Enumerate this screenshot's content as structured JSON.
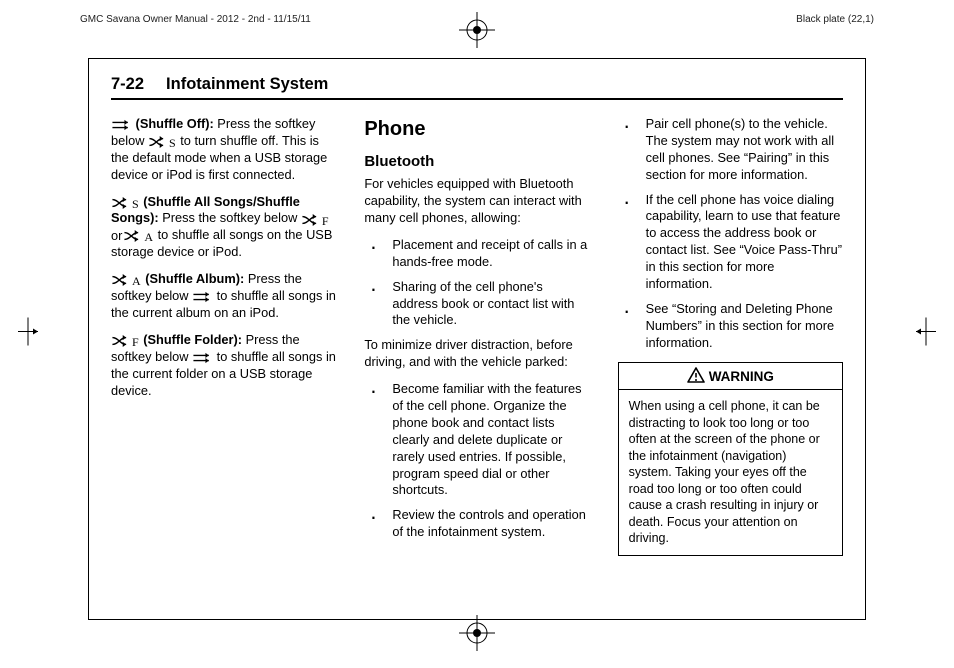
{
  "print": {
    "left_meta": "GMC Savana Owner Manual - 2012 - 2nd - 11/15/11",
    "right_meta": "Black plate (22,1)"
  },
  "header": {
    "page_number": "7-22",
    "section": "Infotainment System"
  },
  "col1": {
    "items": [
      {
        "lead_icons": [
          "arrows-forward"
        ],
        "lead": "(Shuffle Off):",
        "text_pre": "Press the softkey below ",
        "mid_icons": [
          "shuffle-s"
        ],
        "text_post": " to turn shuffle off. This is the default mode when a USB storage device or iPod is first connected."
      },
      {
        "lead_icons": [
          "shuffle-s"
        ],
        "lead": "(Shuffle All Songs/Shuffle Songs):",
        "text_pre": "Press the softkey below ",
        "mid_icons": [
          "shuffle-f",
          "or",
          "shuffle-a"
        ],
        "text_post": " to shuffle all songs on the USB storage device or iPod."
      },
      {
        "lead_icons": [
          "shuffle-a"
        ],
        "lead": "(Shuffle Album):",
        "text_pre": "Press the softkey below ",
        "mid_icons": [
          "arrows-forward"
        ],
        "text_post": " to shuffle all songs in the current album on an iPod."
      },
      {
        "lead_icons": [
          "shuffle-f"
        ],
        "lead": "(Shuffle Folder):",
        "text_pre": "Press the softkey below ",
        "mid_icons": [
          "arrows-forward"
        ],
        "text_post": " to shuffle all songs in the current folder on a USB storage device."
      }
    ]
  },
  "col2": {
    "h1": "Phone",
    "h2": "Bluetooth",
    "intro": "For vehicles equipped with Bluetooth capability, the system can interact with many cell phones, allowing:",
    "bul1": [
      "Placement and receipt of calls in a hands-free mode.",
      "Sharing of the cell phone's address book or contact list with the vehicle."
    ],
    "mid": "To minimize driver distraction, before driving, and with the vehicle parked:",
    "bul2": [
      "Become familiar with the features of the cell phone. Organize the phone book and contact lists clearly and delete duplicate or rarely used entries. If possible, program speed dial or other shortcuts.",
      "Review the controls and operation of the infotainment system."
    ]
  },
  "col3": {
    "bul": [
      "Pair cell phone(s) to the vehicle. The system may not work with all cell phones. See “Pairing” in this section for more information.",
      "If the cell phone has voice dialing capability, learn to use that feature to access the address book or contact list. See “Voice Pass-Thru” in this section for more information.",
      "See “Storing and Deleting Phone Numbers” in this section for more information."
    ],
    "warning": {
      "title": "WARNING",
      "body": "When using a cell phone, it can be distracting to look too long or too often at the screen of the phone or the infotainment (navigation) system. Taking your eyes off the road too long or too often could cause a crash resulting in injury or death. Focus your attention on driving."
    }
  },
  "icons": {
    "arrows-forward": "",
    "shuffle-s": "S",
    "shuffle-a": "A",
    "shuffle-f": "F"
  }
}
